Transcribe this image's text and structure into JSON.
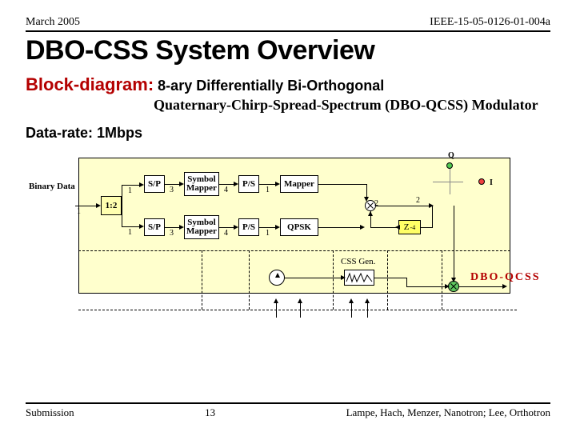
{
  "header": {
    "date": "March 2005",
    "docnum": "IEEE-15-05-0126-01-004a"
  },
  "title": "DBO-CSS System Overview",
  "subtitle": {
    "tag": "Block-diagram:",
    "line1": "8-ary Differentially Bi-Orthogonal",
    "line2": "Quaternary-Chirp-Spread-Spectrum (DBO-QCSS) Modulator"
  },
  "rate": "Data-rate: 1Mbps",
  "labels": {
    "binary": "Binary Data",
    "split": "1:2",
    "sp": "S/P",
    "sym": "Symbol Mapper",
    "ps": "P/S",
    "map": "Mapper",
    "qpsk": "QPSK",
    "zdelay": "Z",
    "zexp": "-4",
    "cssgen": "CSS Gen.",
    "output": "DBO-QCSS",
    "Q": "Q",
    "I": "I"
  },
  "ports": {
    "in1": "1",
    "sp_in": "1",
    "sp_out": "3",
    "ps_in": "4",
    "ps_out": "1",
    "mult_in": "2",
    "z_in": "2"
  },
  "footer": {
    "left": "Submission",
    "page": "13",
    "right": "Lampe, Hach, Menzer, Nanotron; Lee, Orthotron"
  }
}
